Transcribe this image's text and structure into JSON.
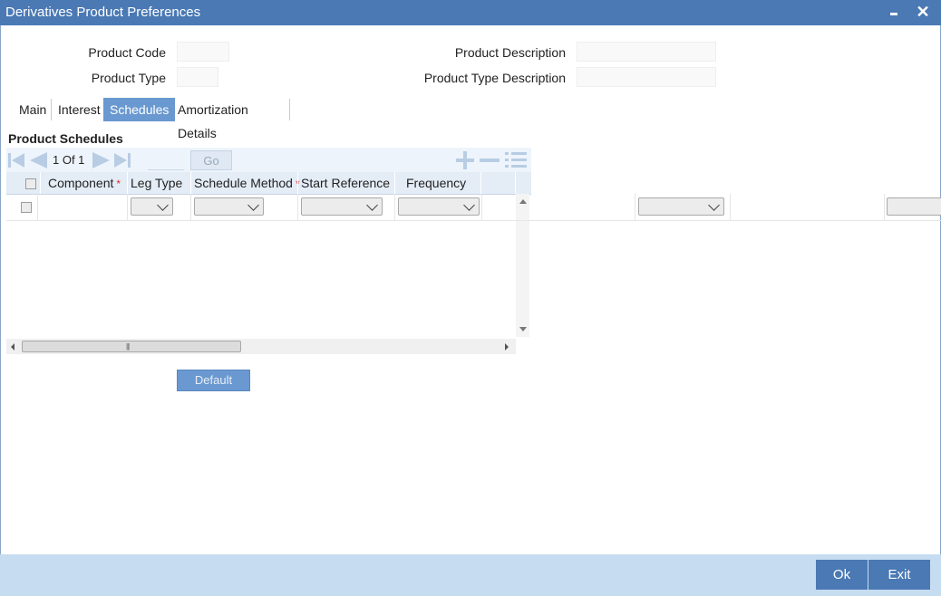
{
  "window": {
    "title": "Derivatives Product Preferences"
  },
  "header": {
    "product_code_label": "Product Code",
    "product_type_label": "Product Type",
    "product_description_label": "Product Description",
    "product_type_description_label": "Product Type Description",
    "product_code_value": "",
    "product_type_value": "",
    "product_description_value": "",
    "product_type_description_value": ""
  },
  "tabs": [
    {
      "label": "Main"
    },
    {
      "label": "Interest"
    },
    {
      "label": "Schedules",
      "active": true
    },
    {
      "label": "Amortization Details"
    }
  ],
  "schedules": {
    "section_title": "Product Schedules",
    "pager": {
      "text": "1 Of 1",
      "go_label": "Go"
    },
    "columns": [
      {
        "label": "Component",
        "required": true
      },
      {
        "label": "Leg Type",
        "required": false
      },
      {
        "label": "Schedule Method",
        "required": true
      },
      {
        "label": "Start Reference",
        "required": false
      },
      {
        "label": "Frequency",
        "required": false
      }
    ],
    "required_marker": "*",
    "rows": [
      {
        "component": "",
        "leg_type": "",
        "schedule_method": "",
        "start_reference": "",
        "frequency": ""
      }
    ]
  },
  "buttons": {
    "default": "Default",
    "ok": "Ok",
    "exit": "Exit"
  },
  "colors": {
    "titlebar": "#4a79b4",
    "active_tab": "#6a98d0",
    "footer": "#c6dcf0",
    "required": "#e03030"
  }
}
